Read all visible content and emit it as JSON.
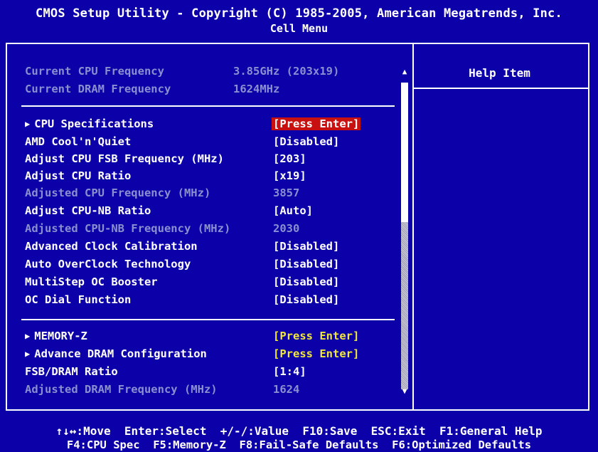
{
  "header": {
    "title": "CMOS Setup Utility - Copyright (C) 1985-2005, American Megatrends, Inc.",
    "subtitle": "Cell Menu"
  },
  "info": [
    {
      "label": "Current CPU Frequency",
      "value": "3.85GHz (203x19)"
    },
    {
      "label": "Current DRAM Frequency",
      "value": "1624MHz"
    }
  ],
  "menu_group1": [
    {
      "label": "CPU Specifications",
      "value": "[Press Enter]",
      "submenu": true,
      "state": "selected"
    },
    {
      "label": "AMD Cool'n'Quiet",
      "value": "[Disabled]",
      "submenu": false,
      "state": "normal"
    },
    {
      "label": "Adjust CPU FSB Frequency (MHz)",
      "value": "[203]",
      "submenu": false,
      "state": "normal"
    },
    {
      "label": "Adjust CPU Ratio",
      "value": "[x19]",
      "submenu": false,
      "state": "normal"
    },
    {
      "label": "Adjusted CPU Frequency (MHz)",
      "value": "3857",
      "submenu": false,
      "state": "readonly"
    },
    {
      "label": "Adjust CPU-NB Ratio",
      "value": "[Auto]",
      "submenu": false,
      "state": "normal"
    },
    {
      "label": "Adjusted CPU-NB Frequency (MHz)",
      "value": "2030",
      "submenu": false,
      "state": "readonly"
    },
    {
      "label": "Advanced Clock Calibration",
      "value": "[Disabled]",
      "submenu": false,
      "state": "normal"
    },
    {
      "label": "Auto OverClock Technology",
      "value": "[Disabled]",
      "submenu": false,
      "state": "normal"
    },
    {
      "label": "MultiStep OC Booster",
      "value": "[Disabled]",
      "submenu": false,
      "state": "normal"
    },
    {
      "label": "OC Dial Function",
      "value": "[Disabled]",
      "submenu": false,
      "state": "normal"
    }
  ],
  "menu_group2": [
    {
      "label": "MEMORY-Z",
      "value": "[Press Enter]",
      "submenu": true,
      "state": "submenu"
    },
    {
      "label": "Advance DRAM Configuration",
      "value": "[Press Enter]",
      "submenu": true,
      "state": "submenu"
    },
    {
      "label": "FSB/DRAM Ratio",
      "value": "[1:4]",
      "submenu": false,
      "state": "normal"
    },
    {
      "label": "Adjusted DRAM Frequency (MHz)",
      "value": "1624",
      "submenu": false,
      "state": "readonly"
    }
  ],
  "help": {
    "title": "Help Item"
  },
  "scroll": {
    "up_glyph": "▲",
    "down_glyph": "▼",
    "position": 0.0
  },
  "footer": {
    "line1": "↑↓↔:Move  Enter:Select  +/-/:Value  F10:Save  ESC:Exit  F1:General Help",
    "line2": "F4:CPU Spec  F5:Memory-Z  F8:Fail-Safe Defaults  F6:Optimized Defaults"
  },
  "colors": {
    "background": "#0c00a8",
    "selected": "#c81010",
    "submenu": "#f0e838",
    "readonly": "#8a8fcf"
  }
}
